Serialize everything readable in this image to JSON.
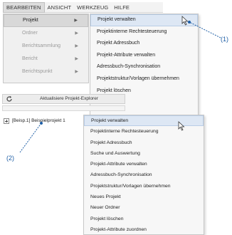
{
  "menubar": {
    "items": [
      "BEARBEITEN",
      "ANSICHT",
      "WERKZEUG",
      "HILFE"
    ]
  },
  "submenu1": {
    "items": [
      "Projekt",
      "Ordner",
      "Berichtsammlung",
      "Bericht",
      "Berichtspunkt"
    ]
  },
  "submenu2": {
    "items": [
      "Projekt verwalten",
      "Projektinterne Rechtesteuerung",
      "Projekt Adressbuch",
      "Projekt-Attribute verwalten",
      "Adressbuch-Synchronisation",
      "Projektstruktur/Vorlagen übernehmen",
      "Projekt löschen"
    ]
  },
  "callouts": {
    "one": "(1)",
    "two": "(2)"
  },
  "explorer": {
    "toolbar_label": "Aktualisiere Projekt-Explorer",
    "tree_item": "[Beisp.1] Beispielprojekt 1"
  },
  "context_menu": {
    "items": [
      "Projekt verwalten",
      "Projektinterne Rechtesteuerung",
      "Projekt Adressbuch",
      "Suche und Auswertung",
      "Projekt-Attribute verwalten",
      "Adressbuch-Synchronisation",
      "Projektstruktur/Vorlagen übernehmen",
      "Neues Projekt",
      "Neuer Ordner",
      "Projekt löschen",
      "Projekt-Attribute zuordnen"
    ]
  },
  "colors": {
    "callout": "#1f5fa6",
    "highlight": "#dde7f4"
  }
}
